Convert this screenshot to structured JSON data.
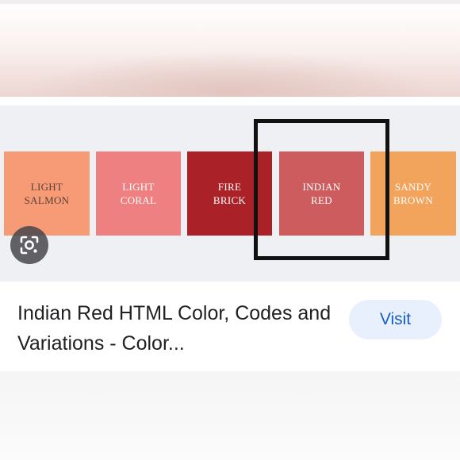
{
  "image_result": {
    "swatches": [
      {
        "line1": "LIGHT",
        "line2": "SALMON",
        "color": "#f79b76",
        "text_color": "#5a4038"
      },
      {
        "line1": "LIGHT",
        "line2": "CORAL",
        "color": "#ee8082",
        "text_color": "#ffffff"
      },
      {
        "line1": "FIRE",
        "line2": "BRICK",
        "color": "#aa2228",
        "text_color": "#ffffff"
      },
      {
        "line1": "INDIAN",
        "line2": "RED",
        "color": "#cc5c5e",
        "text_color": "#ffffff"
      },
      {
        "line1": "SANDY",
        "line2": "BROWN",
        "color": "#f2a45c",
        "text_color": "#ffffff"
      }
    ]
  },
  "result": {
    "title": "Indian Red HTML Color, Codes and Variations - Color...",
    "visit_label": "Visit"
  },
  "colors": {
    "highlight_border": "#111111",
    "visit_bg": "#e8f0fe",
    "visit_text": "#1a5bc4",
    "title_text": "#202124"
  },
  "icons": {
    "lens": "google-lens-icon"
  }
}
